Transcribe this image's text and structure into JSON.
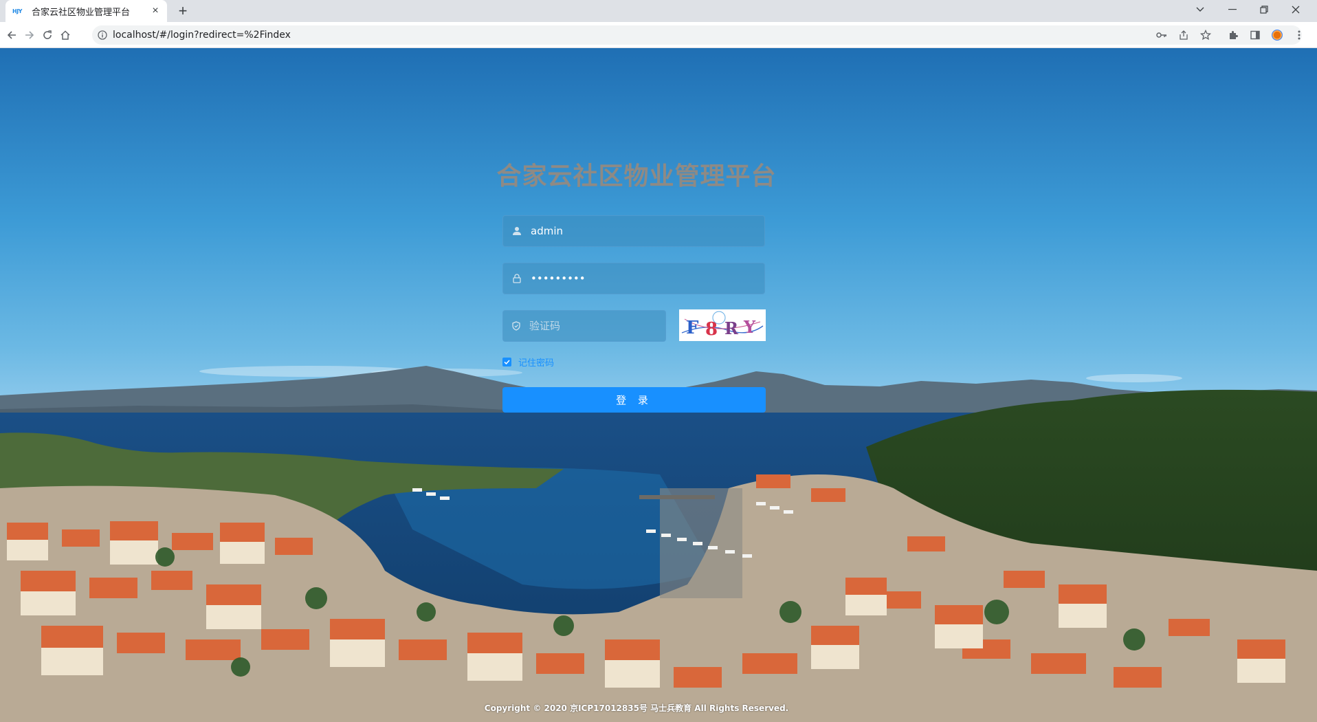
{
  "browser": {
    "tab_title": "合家云社区物业管理平台",
    "tab_favicon_text": "HJY",
    "url": "localhost/#/login?redirect=%2Findex",
    "icons": [
      "back-icon",
      "forward-icon",
      "reload-icon",
      "home-icon",
      "site-info-icon",
      "key-icon",
      "share-icon",
      "bookmark-star-icon",
      "extensions-icon",
      "side-panel-icon",
      "profile-icon",
      "menu-icon",
      "tab-search-icon",
      "minimize-icon",
      "restore-icon",
      "close-window-icon"
    ]
  },
  "login": {
    "title": "合家云社区物业管理平台",
    "username": "admin",
    "password": "•••••••••",
    "captcha_placeholder": "验证码",
    "captcha_text": "F8RY",
    "remember_label": "记住密码",
    "remember_checked": true,
    "login_label": "登 录"
  },
  "footer": {
    "copyright": "Copyright © 2020 京ICP17012835号 马士兵教育 All Rights Reserved."
  },
  "colors": {
    "accent": "#1890ff",
    "title": "#8e8a85",
    "sky": "#2f8fd0"
  }
}
